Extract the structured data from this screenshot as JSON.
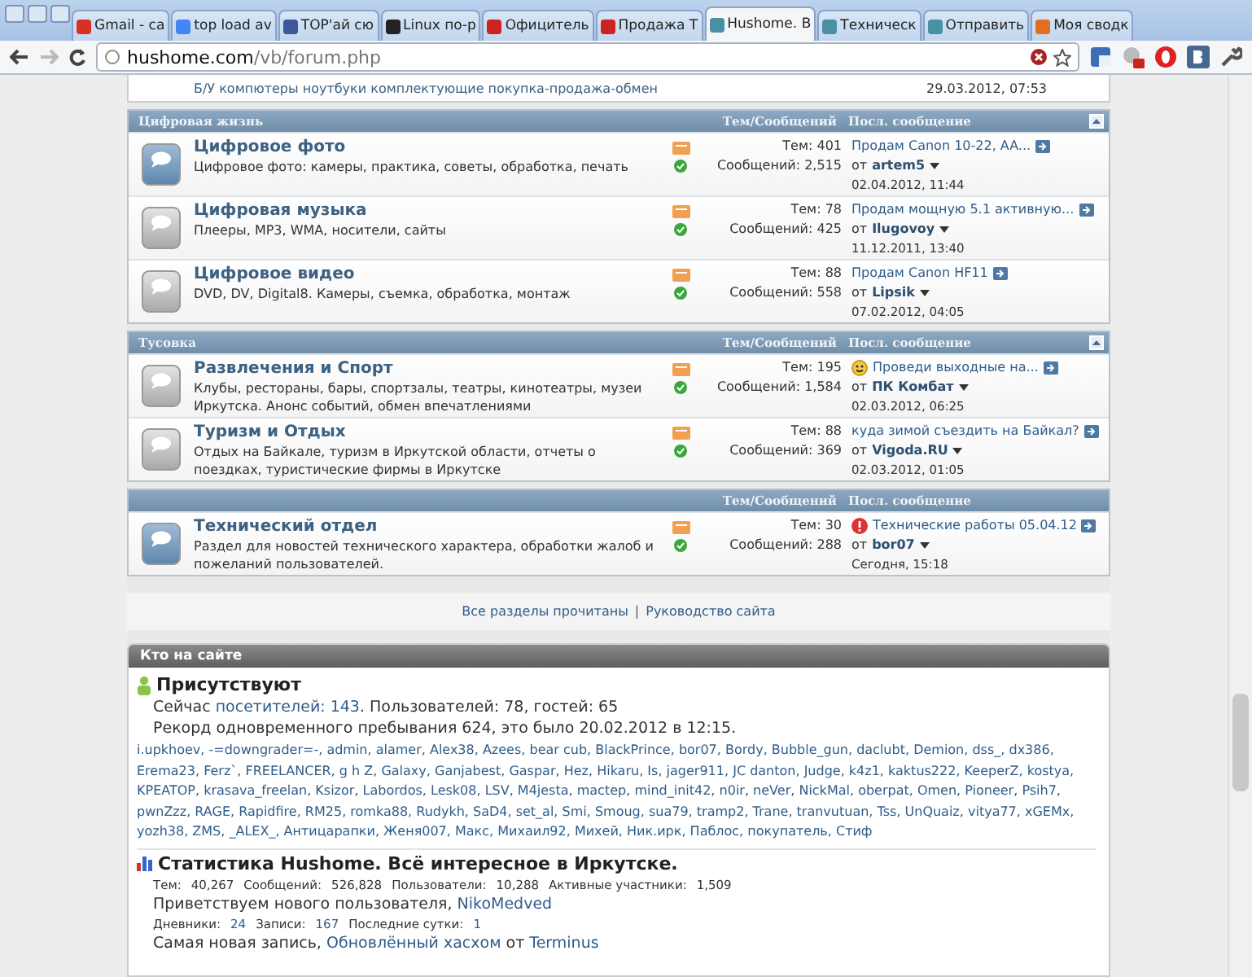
{
  "browser": {
    "tabs": [
      {
        "label": "Gmail - ca",
        "selected": false,
        "color": "#d93025"
      },
      {
        "label": "top load av",
        "selected": false,
        "color": "#4285f4"
      },
      {
        "label": "TOP'ай сю",
        "selected": false,
        "color": "#3b5998"
      },
      {
        "label": "Linux по-р",
        "selected": false,
        "color": "#222222"
      },
      {
        "label": "Официтель",
        "selected": false,
        "color": "#cc2222"
      },
      {
        "label": "Продажа Т",
        "selected": false,
        "color": "#cc2222"
      },
      {
        "label": "Hushome. В",
        "selected": true,
        "color": "#4a90a4"
      },
      {
        "label": "Техническ",
        "selected": false,
        "color": "#4a90a4"
      },
      {
        "label": "Отправить",
        "selected": false,
        "color": "#4a90a4"
      },
      {
        "label": "Моя сводк",
        "selected": false,
        "color": "#e07020"
      }
    ],
    "url_host": "hushome.com",
    "url_path": "/vb/forum.php"
  },
  "partial_row": {
    "description": "Б/У компютеры ноутбуки комплектующие покупка-продажа-обмен",
    "date": "29.03.2012, 07:53"
  },
  "sections": [
    {
      "title": "Цифровая жизнь",
      "col_counts": "Тем/Сообщений",
      "col_last": "Посл. сообщение",
      "collapsible": true,
      "forums": [
        {
          "title": "Цифровое фото",
          "description": "Цифровое фото: камеры, практика, советы, обработка, печать",
          "new_posts": true,
          "threads": "Тем: 401",
          "posts": "Сообщений: 2,515",
          "last_post": {
            "title": "Продам Canon 10-22, AA...",
            "by": "от",
            "user": "artem5",
            "date": "02.04.2012, 11:44"
          }
        },
        {
          "title": "Цифровая музыка",
          "description": "Плееры, MP3, WMA, носители, сайты",
          "new_posts": false,
          "threads": "Тем: 78",
          "posts": "Сообщений: 425",
          "last_post": {
            "title": "Продам мощную 5.1 активную...",
            "by": "от",
            "user": "Ilugovoy",
            "date": "11.12.2011, 13:40"
          }
        },
        {
          "title": "Цифровое видео",
          "description": "DVD, DV, Digital8. Камеры, съемка, обработка, монтаж",
          "new_posts": false,
          "threads": "Тем: 88",
          "posts": "Сообщений: 558",
          "last_post": {
            "title": "Продам Canon HF11",
            "by": "от",
            "user": "Lipsik",
            "date": "07.02.2012, 04:05"
          }
        }
      ]
    },
    {
      "title": "Тусовка",
      "col_counts": "Тем/Сообщений",
      "col_last": "Посл. сообщение",
      "collapsible": true,
      "forums": [
        {
          "title": "Развлечения и Спорт",
          "description": "Клубы, рестораны, бары, спортзалы, театры, кинотеатры, музеи Иркутска. Анонс событий, обмен впечатлениями",
          "new_posts": false,
          "threads": "Тем: 195",
          "posts": "Сообщений: 1,584",
          "last_post": {
            "kind": "smile",
            "title": "Проведи выходные на...",
            "by": "от",
            "user": "ПК Комбат",
            "date": "02.03.2012, 06:25"
          }
        },
        {
          "title": "Туризм и Отдых",
          "description": "Отдых на Байкале, туризм в Иркутской области, отчеты о поездках, туристические фирмы в Иркутске",
          "new_posts": false,
          "threads": "Тем: 88",
          "posts": "Сообщений: 369",
          "last_post": {
            "title": "куда зимой съездить на Байкал?",
            "by": "от",
            "user": "Vigoda.RU",
            "date": "02.03.2012, 01:05"
          }
        }
      ]
    },
    {
      "col_counts": "Тем/Сообщений",
      "col_last": "Посл. сообщение",
      "collapsible": false,
      "forums": [
        {
          "title": "Технический отдел",
          "description": "Раздел для новостей технического характера, обработки жалоб и пожеланий пользователей.",
          "new_posts": true,
          "threads": "Тем: 30",
          "posts": "Сообщений: 288",
          "last_post": {
            "kind": "alert",
            "title": "Технические работы 05.04.12",
            "by": "от",
            "user": "bor07",
            "date": "Сегодня, 15:18"
          }
        }
      ]
    }
  ],
  "footer_links": {
    "links": [
      "Все разделы прочитаны",
      "Руководство сайта"
    ],
    "separator": "|"
  },
  "online": {
    "header": "Кто на сайте",
    "title": "Присутствуют",
    "current": {
      "prefix": "Сейчас",
      "link": "посетителей: 143",
      "suffix": ". Пользователей: 78, гостей: 65"
    },
    "record": "Рекорд одновременного пребывания 624, это было 20.02.2012 в 12:15.",
    "separator": ",",
    "users": [
      "i.upkhoev",
      "-=downgrader=-",
      "admin",
      "alamer",
      "Alex38",
      "Azees",
      "bear cub",
      "BlackPrince",
      "bor07",
      "Bordy",
      "Bubble_gun",
      "daclubt",
      "Demion",
      "dss_",
      "dx386",
      "Erema23",
      "Ferz`",
      "FREELANCER",
      "g h Z",
      "Galaxy",
      "Ganjabest",
      "Gaspar",
      "Hez",
      "Hikaru",
      "Is",
      "jager911",
      "JC danton",
      "Judge",
      "k4z1",
      "kaktus222",
      "KeeperZ",
      "kostya",
      "KPEATOP",
      "krasava_freelan",
      "Ksizor",
      "Labordos",
      "Lesk08",
      "LSV",
      "M4jesta",
      "mactep",
      "mind_init42",
      "n0ir",
      "neVer",
      "NickMal",
      "oberpat",
      "Omen",
      "Pioneer",
      "Psih7",
      "pwnZzz",
      "RAGE",
      "Rapidfire",
      "RM25",
      "romka88",
      "Rudykh",
      "SaD4",
      "set_al",
      "Smi",
      "Smoug",
      "sua79",
      "tramp2",
      "Trane",
      "tranvutuan",
      "Tss",
      "UnQuaiz",
      "vitya77",
      "xGEMx",
      "yozh38",
      "ZMS",
      "_ALEX_",
      "Антицарапки",
      "Женя007",
      "Макс",
      "Михаил92",
      "Михей",
      "Ник.ирк",
      "Паблос",
      "покупатель",
      "Стиф"
    ]
  },
  "stats": {
    "title": "Статистика Hushome. Всё интересное в Иркутске.",
    "counts": [
      {
        "label": "Тем:",
        "value": "40,267"
      },
      {
        "label": "Сообщений:",
        "value": "526,828"
      },
      {
        "label": "Пользователи:",
        "value": "10,288"
      },
      {
        "label": "Активные участники:",
        "value": "1,509"
      }
    ],
    "welcome": {
      "text": "Приветствуем нового пользователя,",
      "user": "NikoMedved"
    },
    "blog_counts": [
      {
        "label": "Дневники:",
        "value": "24"
      },
      {
        "label": "Записи:",
        "value": "167"
      },
      {
        "label": "Последние сутки:",
        "value": "1"
      }
    ],
    "latest": {
      "prefix": "Самая новая запись,",
      "entry": "Обновлённый хасхом",
      "by": "от",
      "user": "Terminus"
    }
  }
}
